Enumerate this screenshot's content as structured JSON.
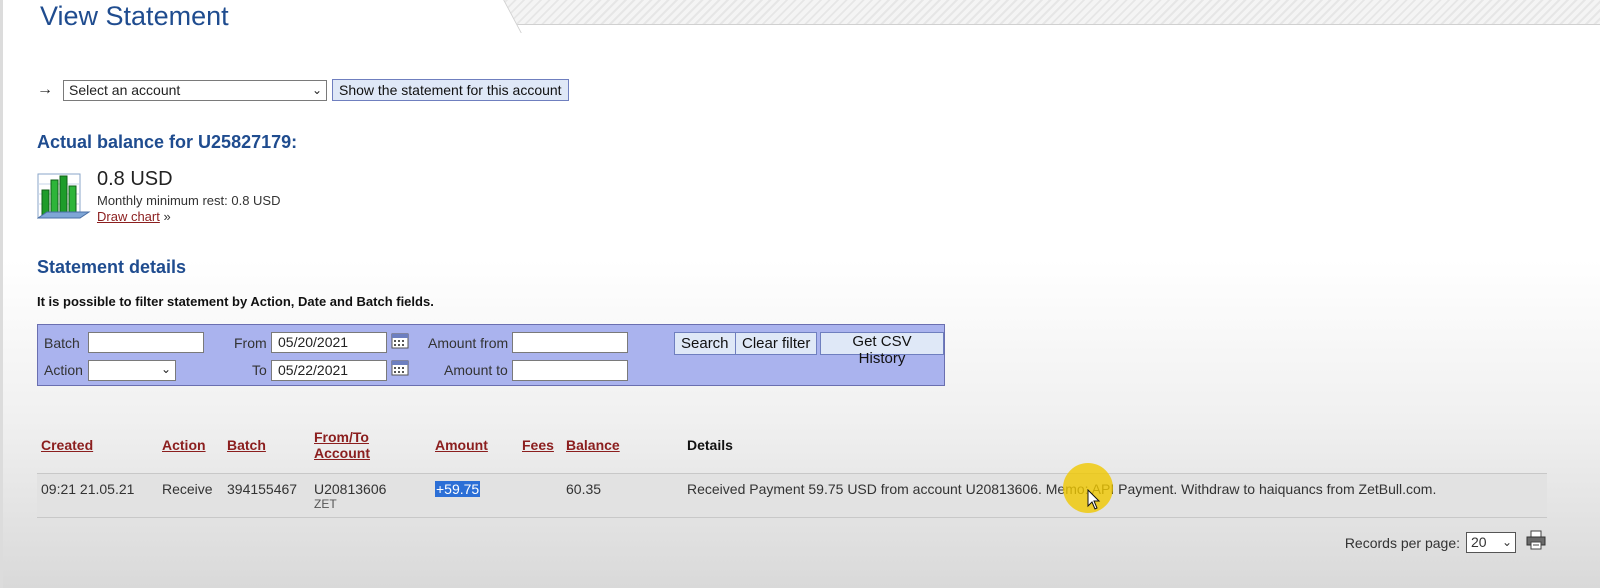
{
  "header": {
    "title": "View Statement"
  },
  "account_select": {
    "arrow": "→",
    "selected": "Select an account",
    "button_label": "Show the statement for this account"
  },
  "balance": {
    "heading": "Actual balance for U25827179:",
    "amount": "0.8 USD",
    "min_rest": "Monthly minimum rest: 0.8 USD",
    "chart_link": "Draw chart",
    "chart_suffix": "»"
  },
  "statement": {
    "heading": "Statement details",
    "filter_note": "It is possible to filter statement by Action, Date and Batch fields."
  },
  "filters": {
    "batch_label": "Batch",
    "batch_value": "",
    "action_label": "Action",
    "action_value": "",
    "from_label": "From",
    "from_value": "05/20/2021",
    "to_label": "To",
    "to_value": "05/22/2021",
    "amount_from_label": "Amount from",
    "amount_from_value": "",
    "amount_to_label": "Amount to",
    "amount_to_value": "",
    "search_label": "Search",
    "clear_label": "Clear filter",
    "csv_label": "Get CSV History"
  },
  "table": {
    "columns": [
      "Created",
      "Action",
      "Batch",
      "From/To Account",
      "Amount",
      "Fees",
      "Balance",
      "Details"
    ],
    "rows": [
      {
        "created": "09:21 21.05.21",
        "action": "Receive",
        "batch": "394155467",
        "account": "U20813606",
        "account_name": "ZET",
        "amount": "+59.75",
        "fees": "",
        "balance": "60.35",
        "details": "Received Payment 59.75 USD from account U20813606. Memo: API Payment. Withdraw to haiquancs from ZetBull.com."
      }
    ]
  },
  "pagination": {
    "records_label": "Records per page:",
    "records_value": "20"
  },
  "colors": {
    "title_blue": "#1f4c8f",
    "link_red": "#8b1e1e",
    "filter_bg": "#aab3ee",
    "highlight": "#2c6fd6",
    "cursor_halo": "#f0c800"
  },
  "icons": [
    "bar-chart-icon",
    "calendar-icon",
    "printer-icon",
    "mouse-cursor-icon"
  ]
}
